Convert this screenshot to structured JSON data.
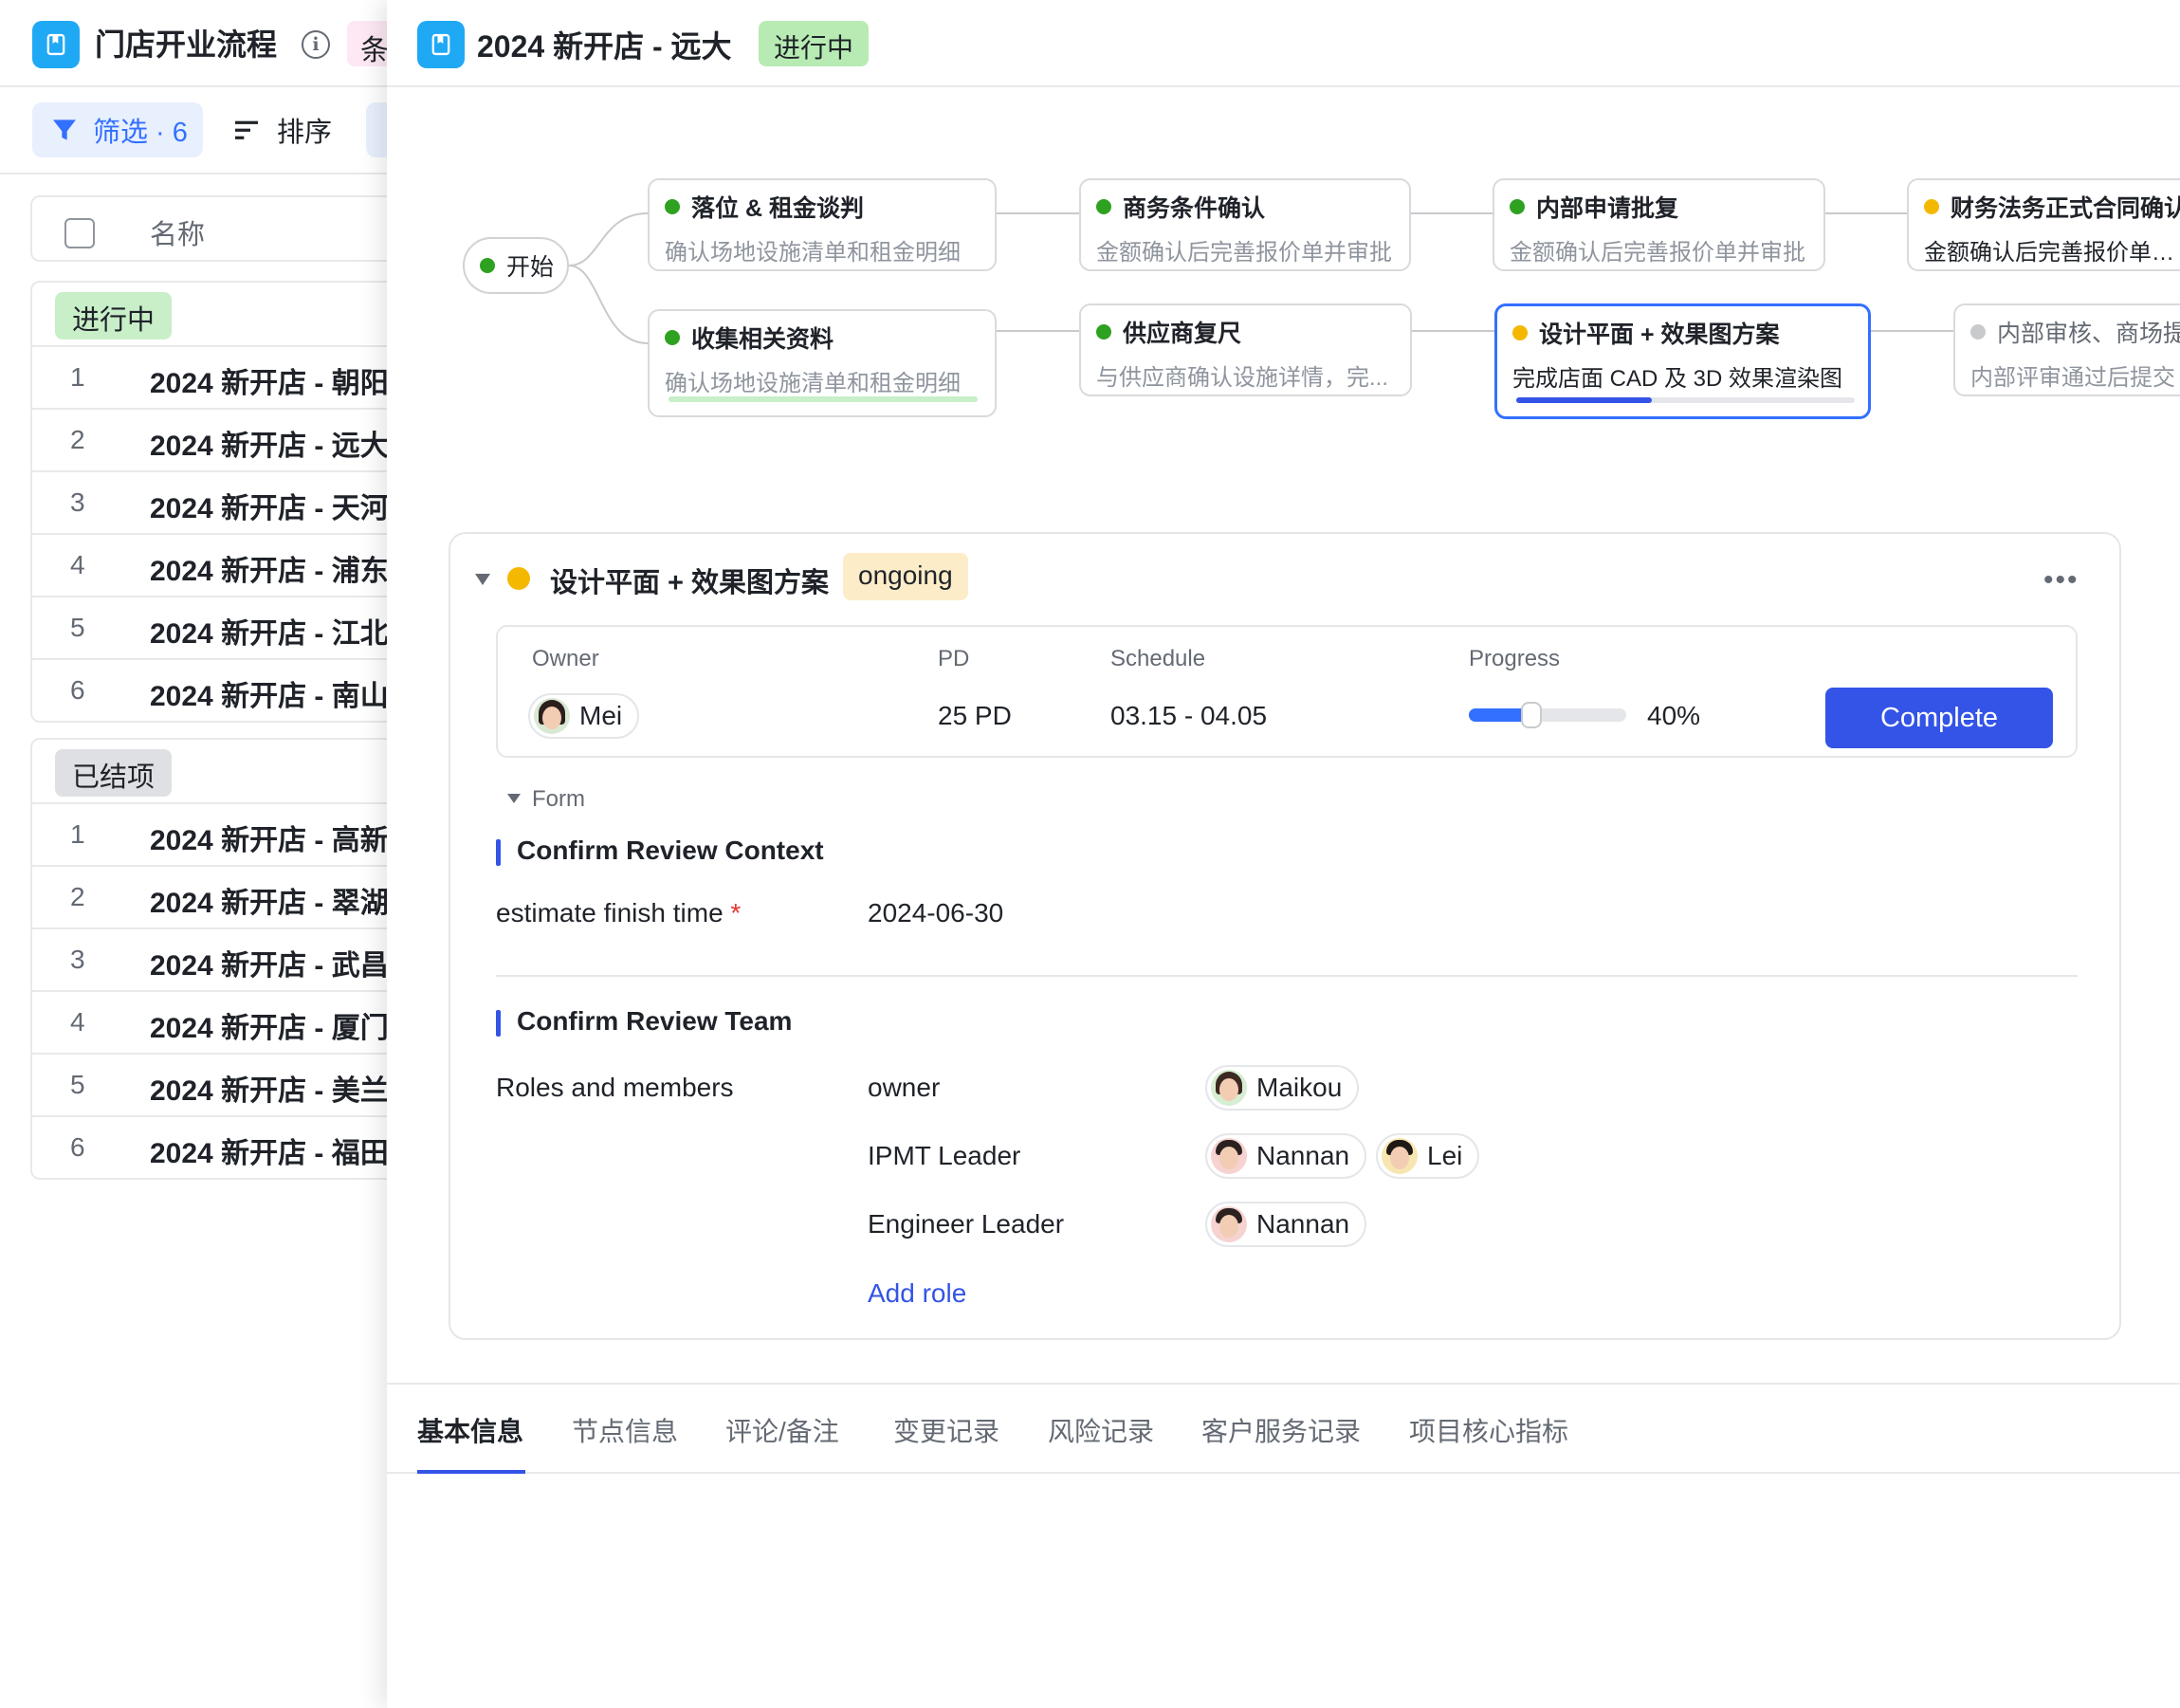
{
  "left": {
    "title": "门店开业流程",
    "chip_text": "条",
    "toolbar": {
      "filter_label": "筛选 · 6",
      "sort_label": "排序"
    },
    "column_header": "名称",
    "groups": [
      {
        "tag": "进行中",
        "rows": [
          {
            "num": "1",
            "name": "2024 新开店 - 朝阳"
          },
          {
            "num": "2",
            "name": "2024 新开店 - 远大"
          },
          {
            "num": "3",
            "name": "2024 新开店 - 天河"
          },
          {
            "num": "4",
            "name": "2024 新开店 - 浦东"
          },
          {
            "num": "5",
            "name": "2024 新开店 - 江北"
          },
          {
            "num": "6",
            "name": "2024 新开店 - 南山"
          }
        ]
      },
      {
        "tag": "已结项",
        "rows": [
          {
            "num": "1",
            "name": "2024 新开店 - 高新"
          },
          {
            "num": "2",
            "name": "2024 新开店 - 翠湖"
          },
          {
            "num": "3",
            "name": "2024 新开店 - 武昌"
          },
          {
            "num": "4",
            "name": "2024 新开店 - 厦门"
          },
          {
            "num": "5",
            "name": "2024 新开店 - 美兰"
          },
          {
            "num": "6",
            "name": "2024 新开店 - 福田"
          }
        ]
      }
    ]
  },
  "detail": {
    "title": "2024 新开店 - 远大",
    "status": "进行中",
    "flow": {
      "start_label": "开始",
      "nodes": [
        {
          "id": "n1",
          "status": "done",
          "title": "落位 & 租金谈判",
          "subtitle": "确认场地设施清单和租金明细"
        },
        {
          "id": "n2",
          "status": "done",
          "title": "商务条件确认",
          "subtitle": "金额确认后完善报价单并审批"
        },
        {
          "id": "n3",
          "status": "done",
          "title": "内部申请批复",
          "subtitle": "金额确认后完善报价单并审批"
        },
        {
          "id": "n4",
          "status": "ongoing",
          "title": "财务法务正式合同确认",
          "subtitle": "金额确认后完善报价单并审批"
        },
        {
          "id": "n5",
          "status": "done",
          "title": "收集相关资料",
          "subtitle": "确认场地设施清单和租金明细",
          "progress": 1.0
        },
        {
          "id": "n6",
          "status": "done",
          "title": "供应商复尺",
          "subtitle": "与供应商确认设施详情，完..."
        },
        {
          "id": "n7",
          "status": "ongoing",
          "title": "设计平面 + 效果图方案",
          "subtitle": "完成店面 CAD 及 3D 效果渲染图",
          "progress": 0.4
        },
        {
          "id": "n8",
          "status": "pending",
          "title": "内部审核、商场提",
          "subtitle": "内部评审通过后提交"
        }
      ]
    },
    "task": {
      "title": "设计平面 + 效果图方案",
      "status_tag": "ongoing",
      "more_icon": "more-horizontal-icon",
      "owner_label": "Owner",
      "owner_name": "Mei",
      "pd_label": "PD",
      "pd_value": "25 PD",
      "schedule_label": "Schedule",
      "schedule_value": "03.15 - 04.05",
      "progress_label": "Progress",
      "progress_value": 0.4,
      "progress_text": "40%",
      "complete_label": "Complete",
      "form_label": "Form",
      "context_title": "Confirm Review Context",
      "estimate_label": "estimate finish time",
      "required_mark": "*",
      "estimate_value": "2024-06-30",
      "team_title": "Confirm Review Team",
      "roles_label": "Roles and members",
      "roles": [
        {
          "role": "owner",
          "members": [
            "Maikou"
          ]
        },
        {
          "role": "IPMT Leader",
          "members": [
            "Nannan",
            "Lei"
          ]
        },
        {
          "role": "Engineer Leader",
          "members": [
            "Nannan"
          ]
        }
      ],
      "add_role_label": "Add role"
    },
    "tabs": [
      "基本信息",
      "节点信息",
      "评论/备注",
      "变更记录",
      "风险记录",
      "客户服务记录",
      "项目核心指标"
    ],
    "active_tab": 0
  },
  "colors": {
    "accent": "#3354e6",
    "app_icon": "#1fa9f5",
    "done": "#2ea121",
    "ongoing": "#f5b800",
    "pending": "#c8cacd",
    "active_border": "#3370ff"
  }
}
